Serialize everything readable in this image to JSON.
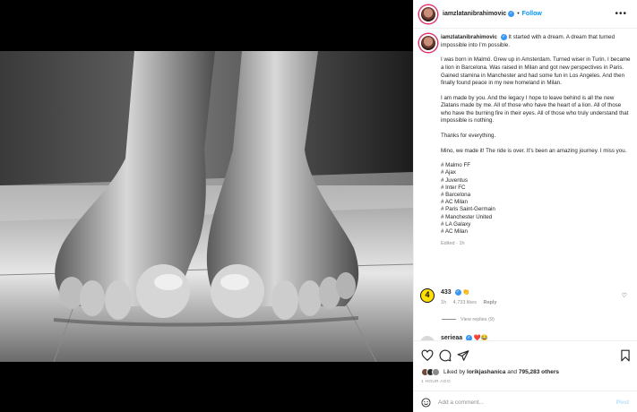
{
  "colors": {
    "accent": "#0095f6",
    "verified": "#3897f0",
    "muted": "#8e8e8e",
    "badge": "#ffe000"
  },
  "post": {
    "username": "iamzlatanibrahimovic",
    "follow_label": "Follow",
    "more_icon": "more-options-icon",
    "caption": {
      "username": "iamzlatanibrahimovic",
      "lead": "It started with a dream. A dream that turned impossible into I’m possible.",
      "paragraphs": [
        "I was born in Malmö. Grew up in Amsterdam. Turned wiser in Turin. I became a lion in Barcelona. Was raised in Milan and got new perspectives in Paris. Gained stamina in Manchester and had some fun in Los Angeles. And then finally found peace in my new homeland in Milan.",
        "I am made by you. And the legacy I hope to leave behind is all the new Zlatans made by me. All of those who have the heart of a lion. All of those who have the burning fire in their eyes. All of those who truly understand that impossible is nothing.",
        "Thanks for everything.",
        "Mino, we made it! The ride is over. It’s been an amazing journey. I miss you."
      ],
      "hashtags": [
        "# Malmo FF",
        "# Ajax",
        "# Juventus",
        "# Inter FC",
        "# Barcelona",
        "# AC Milan",
        "# Paris Saint-Germain",
        "# Manchester United",
        "# LA Galaxy",
        "# AC Milan"
      ],
      "meta": "Edited · 1h"
    },
    "comments": [
      {
        "avatar_text": "4",
        "username": "433",
        "emoji": "👏",
        "time": "1h",
        "likes": "4,733 likes",
        "reply_label": "Reply",
        "view_replies": "View replies (9)"
      },
      {
        "username": "serieaa",
        "emoji": "❤️😂"
      }
    ],
    "actions": {
      "like_icon": "heart-icon",
      "comment_icon": "comment-icon",
      "share_icon": "share-icon",
      "save_icon": "bookmark-icon"
    },
    "likes": {
      "prefix": "Liked by",
      "user": "lorikjashanica",
      "and": "and",
      "count": "795,283 others"
    },
    "posted_ago": "1 HOUR AGO",
    "add_comment": {
      "placeholder": "Add a comment...",
      "post_label": "Post"
    }
  }
}
